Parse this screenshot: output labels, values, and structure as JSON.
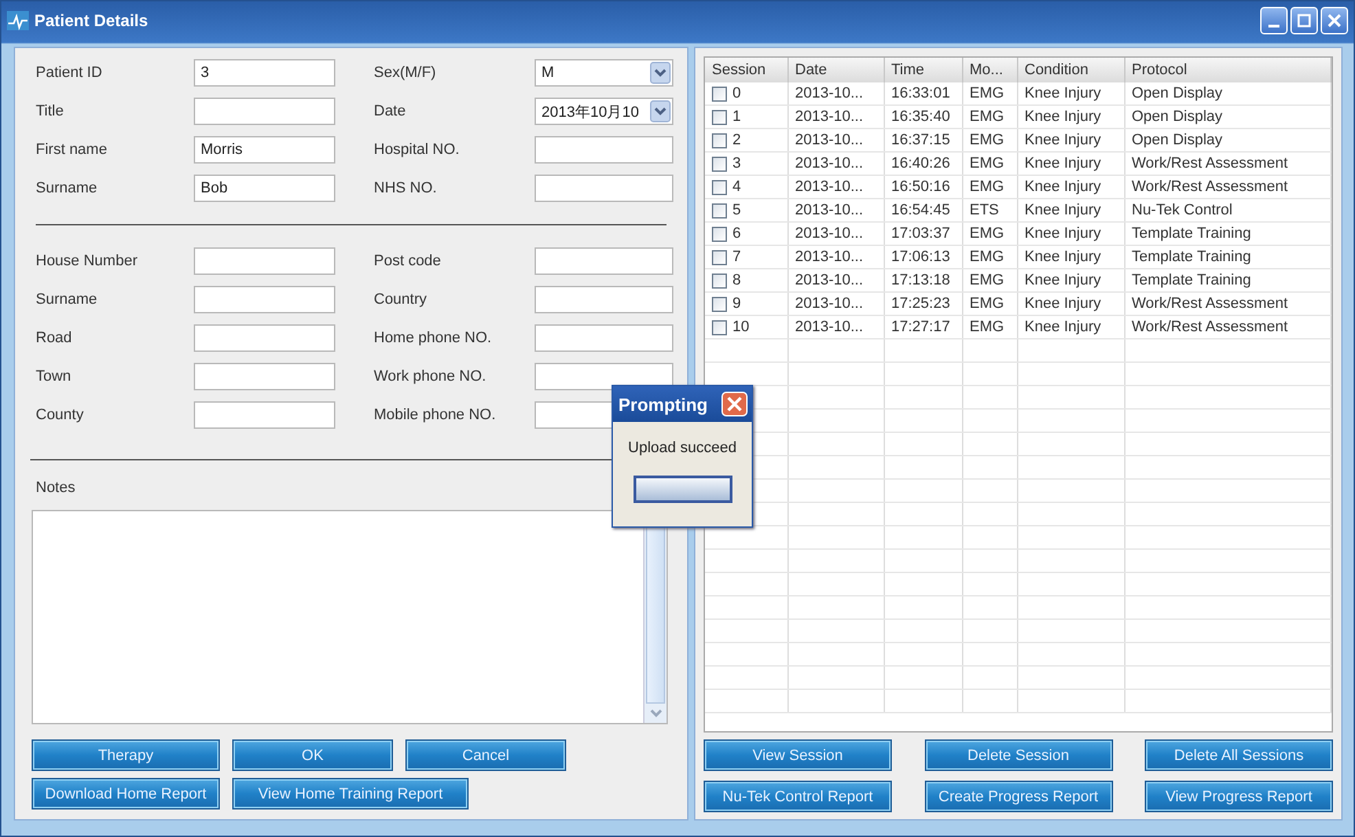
{
  "window": {
    "title": "Patient Details"
  },
  "patient_form": {
    "rows": [
      {
        "label": "Patient ID",
        "value": "3",
        "kind": "text"
      },
      {
        "label": "Sex(M/F)",
        "value": "M",
        "kind": "dropdown"
      },
      {
        "label": "Title",
        "value": "",
        "kind": "text"
      },
      {
        "label": "Date",
        "value": "2013年10月10",
        "kind": "dropdown"
      },
      {
        "label": "First name",
        "value": "Morris",
        "kind": "text"
      },
      {
        "label": "Hospital NO.",
        "value": "",
        "kind": "text"
      },
      {
        "label": "Surname",
        "value": "Bob",
        "kind": "text"
      },
      {
        "label": "NHS NO.",
        "value": "",
        "kind": "text"
      }
    ]
  },
  "address_form": {
    "rows": [
      {
        "label": "House Number",
        "value": "",
        "kind": "text"
      },
      {
        "label": "Post code",
        "value": "",
        "kind": "text"
      },
      {
        "label": "Surname",
        "value": "",
        "kind": "text"
      },
      {
        "label": "Country",
        "value": "",
        "kind": "text"
      },
      {
        "label": "Road",
        "value": "",
        "kind": "text"
      },
      {
        "label": "Home phone NO.",
        "value": "",
        "kind": "text"
      },
      {
        "label": "Town",
        "value": "",
        "kind": "text"
      },
      {
        "label": "Work phone NO.",
        "value": "",
        "kind": "text"
      },
      {
        "label": "County",
        "value": "",
        "kind": "text"
      },
      {
        "label": "Mobile phone NO.",
        "value": "",
        "kind": "text"
      }
    ]
  },
  "notes": {
    "label": "Notes"
  },
  "left_buttons": [
    [
      "Therapy",
      "OK",
      "Cancel"
    ],
    [
      "Download Home Report",
      "View Home Training Report"
    ]
  ],
  "sessions_table": {
    "columns": [
      "Session",
      "Date",
      "Time",
      "Mo...",
      "Condition",
      "Protocol"
    ],
    "rows": [
      {
        "checked": false,
        "cells": [
          "0",
          "2013-10...",
          "16:33:01",
          "EMG",
          "Knee Injury",
          "Open Display"
        ]
      },
      {
        "checked": false,
        "cells": [
          "1",
          "2013-10...",
          "16:35:40",
          "EMG",
          "Knee Injury",
          "Open Display"
        ]
      },
      {
        "checked": false,
        "cells": [
          "2",
          "2013-10...",
          "16:37:15",
          "EMG",
          "Knee Injury",
          "Open Display"
        ]
      },
      {
        "checked": false,
        "cells": [
          "3",
          "2013-10...",
          "16:40:26",
          "EMG",
          "Knee Injury",
          "Work/Rest Assessment"
        ]
      },
      {
        "checked": false,
        "cells": [
          "4",
          "2013-10...",
          "16:50:16",
          "EMG",
          "Knee Injury",
          "Work/Rest Assessment"
        ]
      },
      {
        "checked": false,
        "cells": [
          "5",
          "2013-10...",
          "16:54:45",
          "ETS",
          "Knee Injury",
          "Nu-Tek Control"
        ]
      },
      {
        "checked": false,
        "cells": [
          "6",
          "2013-10...",
          "17:03:37",
          "EMG",
          "Knee Injury",
          "Template Training"
        ]
      },
      {
        "checked": false,
        "cells": [
          "7",
          "2013-10...",
          "17:06:13",
          "EMG",
          "Knee Injury",
          "Template Training"
        ]
      },
      {
        "checked": false,
        "cells": [
          "8",
          "2013-10...",
          "17:13:18",
          "EMG",
          "Knee Injury",
          "Template Training"
        ]
      },
      {
        "checked": false,
        "cells": [
          "9",
          "2013-10...",
          "17:25:23",
          "EMG",
          "Knee Injury",
          "Work/Rest Assessment"
        ]
      },
      {
        "checked": false,
        "cells": [
          "10",
          "2013-10...",
          "17:27:17",
          "EMG",
          "Knee Injury",
          "Work/Rest Assessment"
        ]
      }
    ]
  },
  "right_buttons": [
    [
      "View Session",
      "Delete Session",
      "Delete All Sessions"
    ],
    [
      "Nu-Tek Control Report",
      "Create Progress Report",
      "View Progress Report"
    ]
  ],
  "dialog": {
    "title": "Prompting",
    "message": "Upload succeed"
  }
}
